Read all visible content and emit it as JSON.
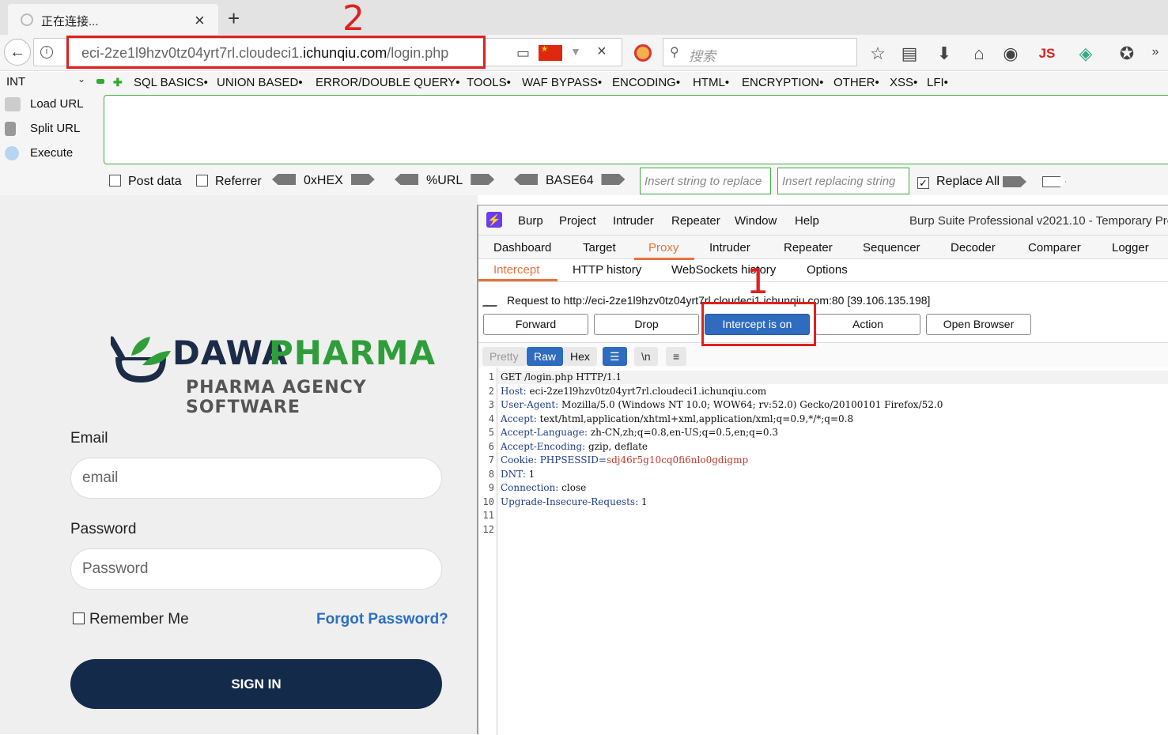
{
  "browser": {
    "tab_title": "正在连接...",
    "url_prefix": "eci-2ze1l9hzv0tz04yrt7rl.cloudeci1.",
    "url_domain": "ichunqiu.com",
    "url_path": "/login.php",
    "search_placeholder": "搜索",
    "js_label": "JS"
  },
  "hackbar": {
    "mode": "INT",
    "menus": [
      "SQL BASICS•",
      "UNION BASED•",
      "ERROR/DOUBLE QUERY•",
      "TOOLS•",
      "WAF BYPASS•",
      "ENCODING•",
      "HTML•",
      "ENCRYPTION•",
      "OTHER•",
      "XSS•",
      "LFI•"
    ],
    "actions": [
      "Load URL",
      "Split URL",
      "Execute"
    ],
    "post_data": "Post data",
    "referrer": "Referrer",
    "hex": "0xHEX",
    "url_enc": "%URL",
    "base64": "BASE64",
    "insert_replace_ph": "Insert string to replace",
    "insert_replacing_ph": "Insert replacing string",
    "replace_all": "Replace All"
  },
  "login": {
    "logo_dawa": "DAWA",
    "logo_pharma": "PHARMA",
    "logo_sub": "PHARMA AGENCY SOFTWARE",
    "email_label": "Email",
    "email_placeholder": "email",
    "password_label": "Password",
    "password_placeholder": "Password",
    "remember": "Remember Me",
    "forgot": "Forgot Password?",
    "signin": "SIGN IN"
  },
  "burp": {
    "menu": [
      "Burp",
      "Project",
      "Intruder",
      "Repeater",
      "Window",
      "Help"
    ],
    "title": "Burp Suite Professional v2021.10 - Temporary Pro",
    "tabs": [
      "Dashboard",
      "Target",
      "Proxy",
      "Intruder",
      "Repeater",
      "Sequencer",
      "Decoder",
      "Comparer",
      "Logger"
    ],
    "proxy_tabs": [
      "Intercept",
      "HTTP history",
      "WebSockets history",
      "Options"
    ],
    "request_line": "Request to http://eci-2ze1l9hzv0tz04yrt7rl.cloudeci1.ichunqiu.com:80  [39.106.135.198]",
    "buttons": [
      "Forward",
      "Drop",
      "Intercept is on",
      "Action",
      "Open Browser"
    ],
    "editor_tabs": [
      "Pretty",
      "Raw",
      "Hex"
    ],
    "newline_icon": "\\n",
    "lines": [
      {
        "k": "",
        "v": "GET /login.php HTTP/1.1"
      },
      {
        "k": "Host:",
        "v": " eci-2ze1l9hzv0tz04yrt7rl.cloudeci1.ichunqiu.com"
      },
      {
        "k": "User-Agent:",
        "v": " Mozilla/5.0 (Windows NT 10.0; WOW64; rv:52.0) Gecko/20100101 Firefox/52.0"
      },
      {
        "k": "Accept:",
        "v": " text/html,application/xhtml+xml,application/xml;q=0.9,*/*;q=0.8"
      },
      {
        "k": "Accept-Language:",
        "v": " zh-CN,zh;q=0.8,en-US;q=0.5,en;q=0.3"
      },
      {
        "k": "Accept-Encoding:",
        "v": " gzip, deflate"
      },
      {
        "k": "Cookie:",
        "v": " PHPSESSID=",
        "c": "sdj46r5g10cq0fi6nlo0gdigmp"
      },
      {
        "k": "DNT:",
        "v": " 1"
      },
      {
        "k": "Connection:",
        "v": " close"
      },
      {
        "k": "Upgrade-Insecure-Requests:",
        "v": " 1"
      },
      {
        "k": "",
        "v": ""
      },
      {
        "k": "",
        "v": ""
      }
    ]
  },
  "annotations": {
    "one": "1",
    "two": "2"
  },
  "colors": {
    "accent": "#e8733a",
    "intercept_btn": "#2f6bbf",
    "annotation": "#e02020",
    "signin": "#142a4a",
    "pharma_green": "#2f9e3a"
  }
}
